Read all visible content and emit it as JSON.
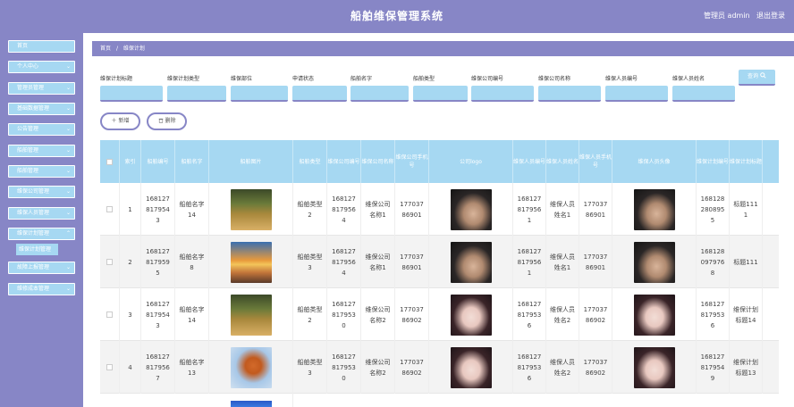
{
  "header": {
    "title": "船舶维保管理系统",
    "admin": "管理员 admin",
    "logout": "退出登录"
  },
  "sidebar": {
    "items": [
      {
        "label": "首页",
        "chev": ""
      },
      {
        "label": "个人中心",
        "chev": "⌄"
      },
      {
        "label": "管理员管理",
        "chev": "⌄"
      },
      {
        "label": "基础数据管理",
        "chev": "⌄"
      },
      {
        "label": "公告管理",
        "chev": "⌄"
      },
      {
        "label": "船舶管理",
        "chev": "⌄"
      },
      {
        "label": "船舶管理",
        "chev": "⌄"
      },
      {
        "label": "维保公司管理",
        "chev": "⌄"
      },
      {
        "label": "维保人员管理",
        "chev": "⌄"
      },
      {
        "label": "维保计划管理",
        "chev": "⌃"
      }
    ],
    "sub": "维保计划管理",
    "items2": [
      {
        "label": "故障上报管理",
        "chev": "⌄"
      },
      {
        "label": "维修成本管理",
        "chev": "⌄"
      }
    ]
  },
  "breadcrumb": {
    "home": "首页",
    "sep": "/",
    "current": "维保计划"
  },
  "filters": [
    {
      "label": "维保计划标题"
    },
    {
      "label": "维保计划类型"
    },
    {
      "label": "维保部位"
    },
    {
      "label": "申请状态"
    },
    {
      "label": "船舶名字"
    },
    {
      "label": "船舶类型"
    },
    {
      "label": "维保公司编号"
    },
    {
      "label": "维保公司名称"
    },
    {
      "label": "维保人员编号"
    },
    {
      "label": "维保人员姓名"
    }
  ],
  "search_button": "查询",
  "search_icon": "search-icon",
  "actions": {
    "add": "＋ 新增",
    "delete": "删除"
  },
  "table": {
    "headers": [
      "",
      "索引",
      "船舶编号",
      "船舶名字",
      "船舶图片",
      "船舶类型",
      "维保公司编号",
      "维保公司名称",
      "维保公司手机号",
      "公司logo",
      "维保人员编号",
      "维保人员姓名",
      "维保人员手机号",
      "维保人员头像",
      "维保计划编号",
      "维保计划标题"
    ],
    "rows": [
      {
        "idx": "1",
        "ship_no": "1681278179543",
        "ship_name": "船舶名字14",
        "ship_img": "landscape",
        "ship_type": "船舶类型2",
        "co_no": "1681278179564",
        "co_name": "维保公司名称1",
        "co_phone": "17703786901",
        "logo": "man",
        "staff_no": "1681278179561",
        "staff_name": "维保人员姓名1",
        "staff_phone": "17703786901",
        "avatar": "man",
        "plan_no": "1681282808955",
        "plan_title": "标题1111"
      },
      {
        "idx": "2",
        "ship_no": "1681278179595",
        "ship_name": "船舶名字8",
        "ship_img": "sunset",
        "ship_type": "船舶类型3",
        "co_no": "1681278179564",
        "co_name": "维保公司名称1",
        "co_phone": "17703786901",
        "logo": "man",
        "staff_no": "1681278179561",
        "staff_name": "维保人员姓名1",
        "staff_phone": "17703786901",
        "avatar": "man",
        "plan_no": "1681280979768",
        "plan_title": "标题111"
      },
      {
        "idx": "3",
        "ship_no": "1681278179543",
        "ship_name": "船舶名字14",
        "ship_img": "landscape",
        "ship_type": "船舶类型2",
        "co_no": "1681278179530",
        "co_name": "维保公司名称2",
        "co_phone": "17703786902",
        "logo": "girl",
        "staff_no": "1681278179536",
        "staff_name": "维保人员姓名2",
        "staff_phone": "17703786902",
        "avatar": "girl",
        "plan_no": "1681278179536",
        "plan_title": "维保计划标题14"
      },
      {
        "idx": "4",
        "ship_no": "1681278179567",
        "ship_name": "船舶名字13",
        "ship_img": "autumn",
        "ship_type": "船舶类型3",
        "co_no": "1681278179530",
        "co_name": "维保公司名称2",
        "co_phone": "17703786902",
        "logo": "girl",
        "staff_no": "1681278179536",
        "staff_name": "维保人员姓名2",
        "staff_phone": "17703786902",
        "avatar": "girl",
        "plan_no": "1681278179549",
        "plan_title": "维保计划标题13"
      }
    ]
  }
}
